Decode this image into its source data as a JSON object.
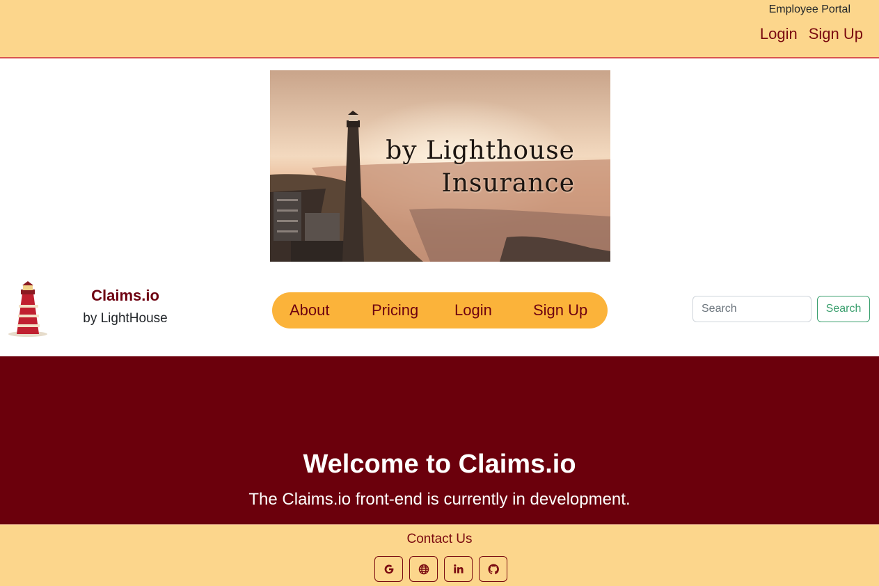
{
  "header": {
    "portal_label": "Employee Portal",
    "login_label": "Login",
    "signup_label": "Sign Up"
  },
  "banner": {
    "line1": "by Lighthouse",
    "line2": "Insurance"
  },
  "brand": {
    "name": "Claims.io",
    "tagline": "by LightHouse"
  },
  "nav": {
    "items": [
      {
        "label": "About"
      },
      {
        "label": "Pricing"
      },
      {
        "label": "Login"
      },
      {
        "label": "Sign Up"
      }
    ]
  },
  "search": {
    "placeholder": "Search",
    "button_label": "Search"
  },
  "hero": {
    "title": "Welcome to Claims.io",
    "subtitle": "The Claims.io front-end is currently in development."
  },
  "footer": {
    "contact_label": "Contact Us",
    "socials": [
      "google-icon",
      "globe-icon",
      "linkedin-icon",
      "github-icon"
    ]
  },
  "colors": {
    "top_bar": "#fcd68c",
    "nav_pill": "#fbb33a",
    "hero_bg": "#6b000c",
    "brand_red": "#6d0010",
    "search_green": "#3a9f6e"
  }
}
